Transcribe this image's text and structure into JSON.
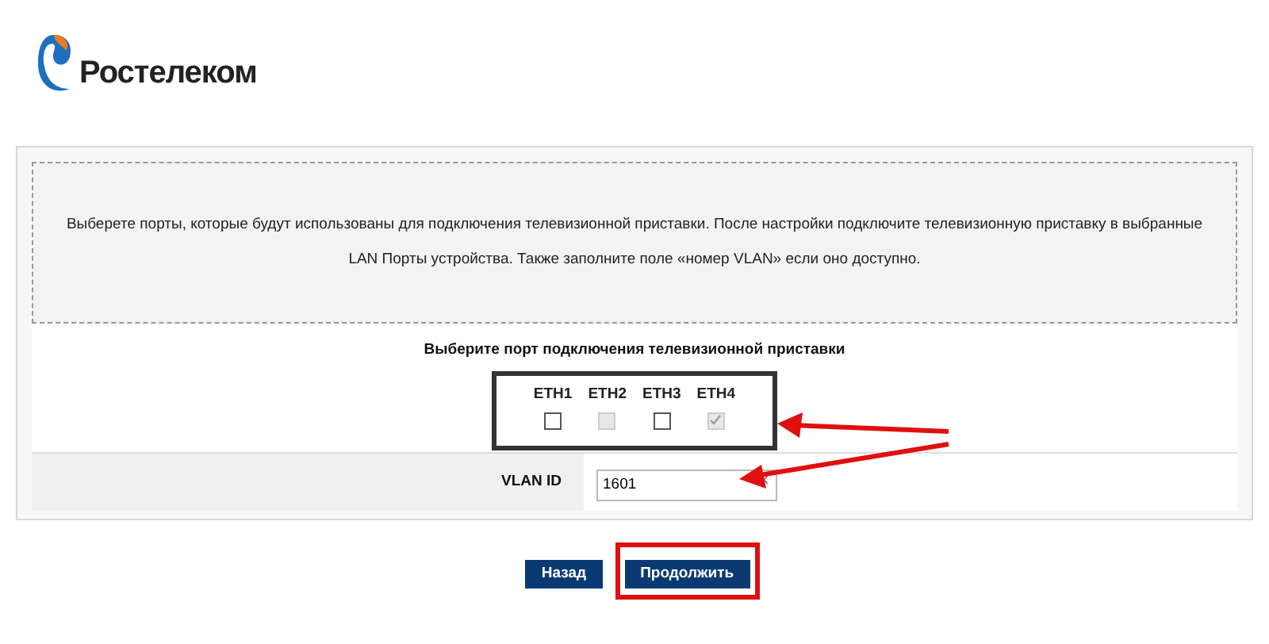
{
  "logo": {
    "text": "Ростелеком"
  },
  "info": {
    "lines": [
      "Выберете порты, которые будут использованы для подключения телевизионной приставки. После настройки подключите телевизионную приставку в выбранные",
      "LAN Порты устройства. Также заполните поле «номер VLAN» если оно доступно."
    ]
  },
  "ports": {
    "title": "Выберите порт подключения телевизионной приставки",
    "items": [
      {
        "label": "ETH1",
        "checked": false,
        "disabled": false
      },
      {
        "label": "ETH2",
        "checked": false,
        "disabled": true
      },
      {
        "label": "ETH3",
        "checked": false,
        "disabled": false
      },
      {
        "label": "ETH4",
        "checked": true,
        "disabled": true
      }
    ]
  },
  "vlan": {
    "label": "VLAN ID",
    "value": "1601"
  },
  "buttons": [
    {
      "label": "Назад",
      "highlighted": false
    },
    {
      "label": "Продолжить",
      "highlighted": true
    }
  ]
}
